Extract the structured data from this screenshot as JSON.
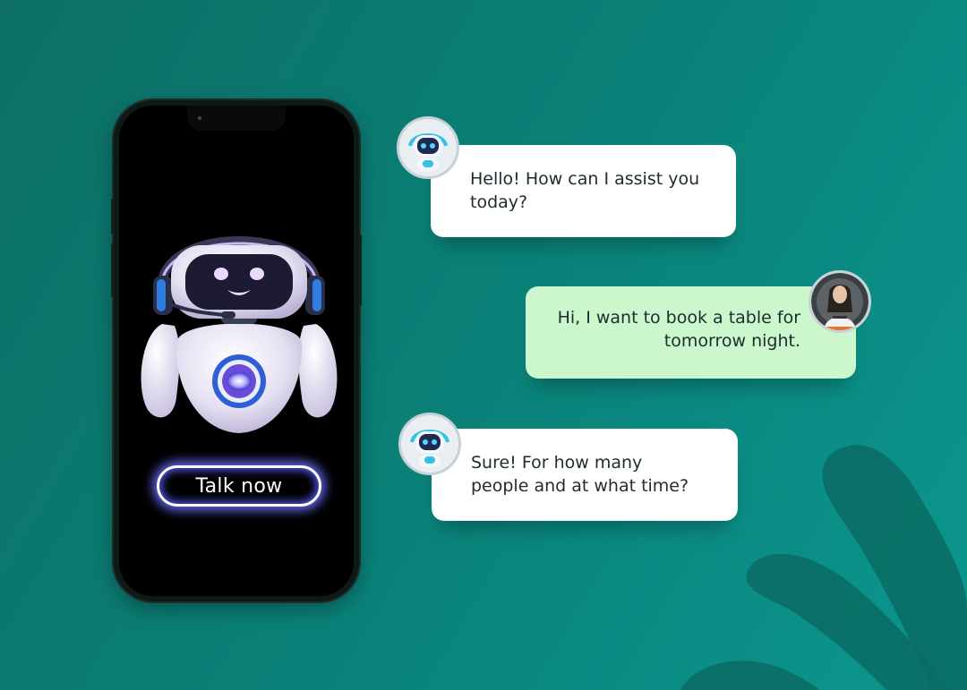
{
  "phone": {
    "cta_label": "Talk now"
  },
  "chat": {
    "messages": [
      {
        "sender": "bot",
        "text": "Hello! How can I assist you today?"
      },
      {
        "sender": "user",
        "text": "Hi, I want to book a table for tomorrow night."
      },
      {
        "sender": "bot",
        "text": "Sure! For how many people and at what time?"
      }
    ]
  },
  "colors": {
    "background": "#0b7f77",
    "bot_bubble": "#ffffff",
    "user_bubble": "#ccf7cc",
    "button_glow": "#6b6dff",
    "text": "#1e2b2f"
  },
  "icons": [
    "bot-avatar-icon",
    "user-avatar-icon",
    "robot-illustration"
  ]
}
